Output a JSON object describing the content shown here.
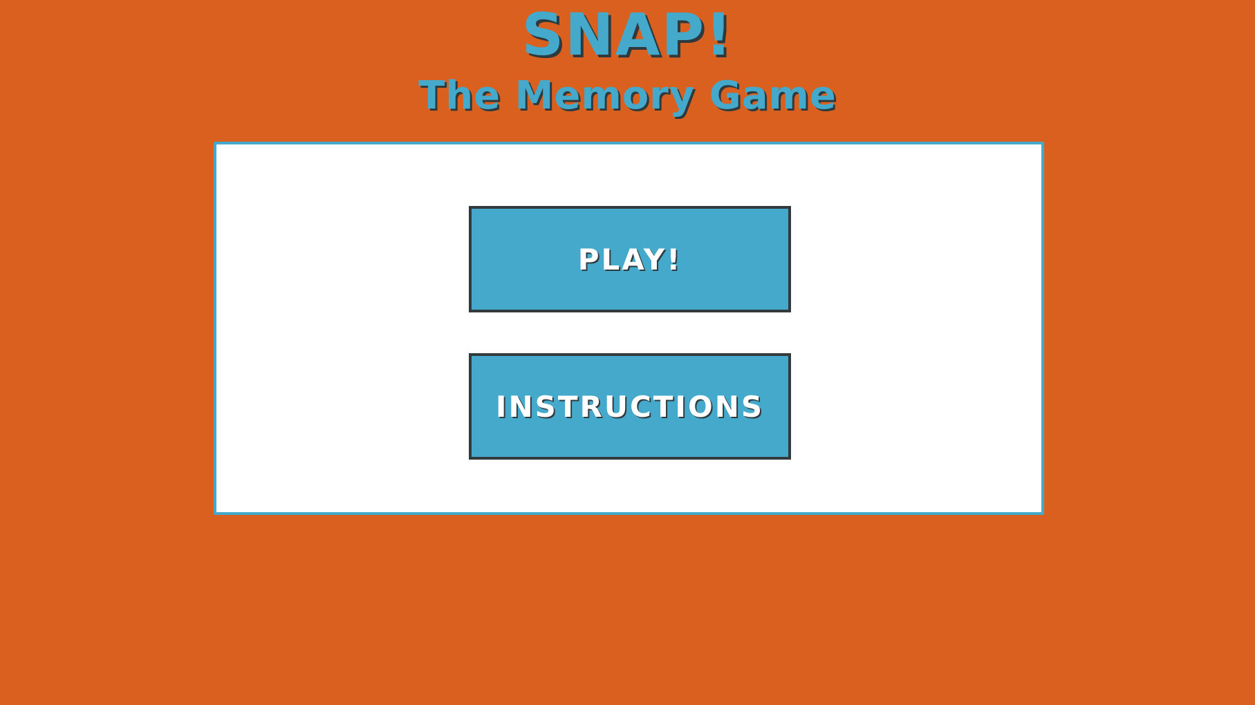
{
  "game": {
    "title": "SNAP!",
    "subtitle": "The Memory Game"
  },
  "menu": {
    "play_label": "PLAY!",
    "instructions_label": "INSTRUCTIONS"
  },
  "colors": {
    "background": "#DA601F",
    "accent": "#44A9CA",
    "panel": "#FFFFFF",
    "button_border": "#333A3D",
    "text_shadow": "#2F3A3E"
  }
}
